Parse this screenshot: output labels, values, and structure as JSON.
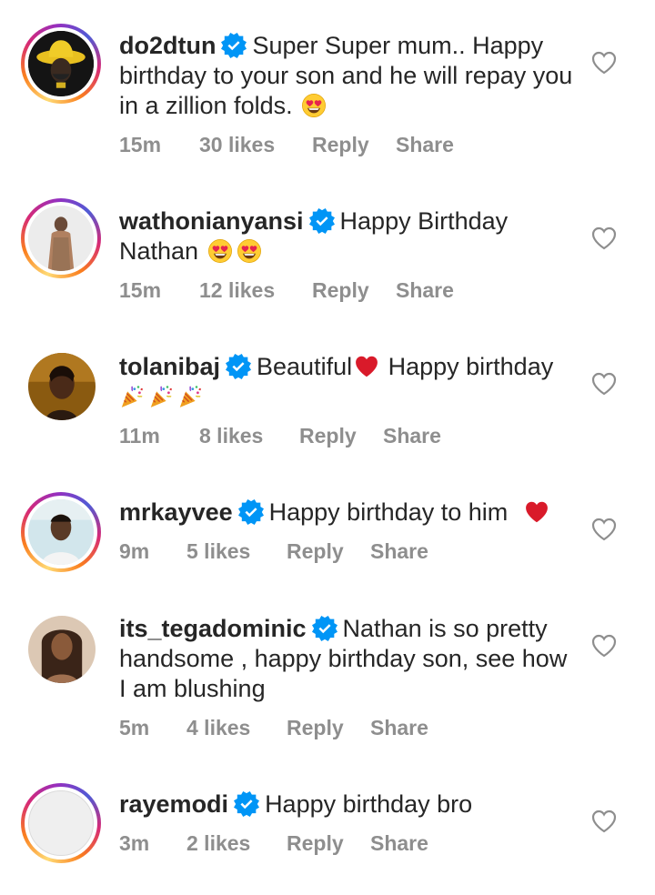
{
  "comments": [
    {
      "username": "do2dtun",
      "text": "Super Super mum.. Happy birthday to your son and he will repay you in a zillion folds.",
      "emojis": [
        "heart-eyes"
      ],
      "time": "15m",
      "likes": "30 likes",
      "reply_label": "Reply",
      "share_label": "Share",
      "story_ring": true
    },
    {
      "username": "wathonianyansi",
      "text": "Happy Birthday Nathan",
      "emojis": [
        "heart-eyes",
        "heart-eyes"
      ],
      "time": "15m",
      "likes": "12 likes",
      "reply_label": "Reply",
      "share_label": "Share",
      "story_ring": true
    },
    {
      "username": "tolanibaj",
      "text_before": "Beautiful",
      "text_after": "Happy birthday",
      "emojis": [
        "red-heart",
        "party-popper",
        "party-popper",
        "party-popper"
      ],
      "time": "11m",
      "likes": "8 likes",
      "reply_label": "Reply",
      "share_label": "Share",
      "story_ring": false
    },
    {
      "username": "mrkayvee",
      "text": "Happy birthday to him",
      "emojis": [
        "red-heart"
      ],
      "time": "9m",
      "likes": "5 likes",
      "reply_label": "Reply",
      "share_label": "Share",
      "story_ring": true
    },
    {
      "username": "its_tegadominic",
      "text": "Nathan is so pretty handsome , happy birthday son, see how I am blushing",
      "emojis": [],
      "time": "5m",
      "likes": "4 likes",
      "reply_label": "Reply",
      "share_label": "Share",
      "story_ring": false
    },
    {
      "username": "rayemodi",
      "text": "Happy birthday bro",
      "emojis": [],
      "time": "3m",
      "likes": "2 likes",
      "reply_label": "Reply",
      "share_label": "Share",
      "story_ring": true
    }
  ],
  "colors": {
    "text": "#262626",
    "meta": "#8e8e8e",
    "verified": "#0095f6",
    "heart": "#e0245e"
  }
}
